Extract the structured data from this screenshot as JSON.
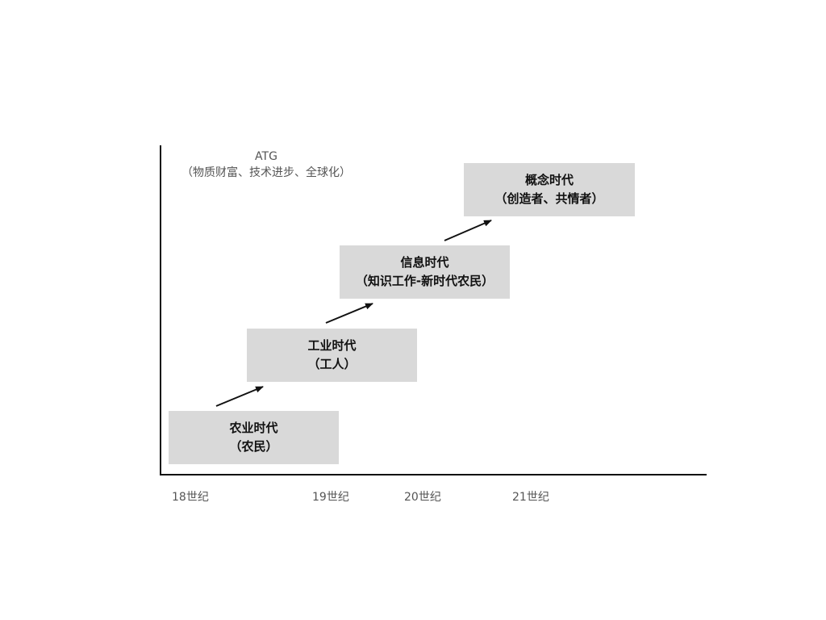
{
  "note": {
    "line1": "ATG",
    "line2": "（物质财富、技术进步、全球化）"
  },
  "eras": [
    {
      "name": "农业时代",
      "role": "（农民）"
    },
    {
      "name": "工业时代",
      "role": "（工人）"
    },
    {
      "name": "信息时代",
      "role": "（知识工作-新时代农民）"
    },
    {
      "name": "概念时代",
      "role": "（创造者、共情者）"
    }
  ],
  "ticks": [
    "18世纪",
    "19世纪",
    "20世纪",
    "21世纪"
  ],
  "colors": {
    "box_fill": "#d9d9d9",
    "axis": "#111111",
    "muted_text": "#555555"
  }
}
